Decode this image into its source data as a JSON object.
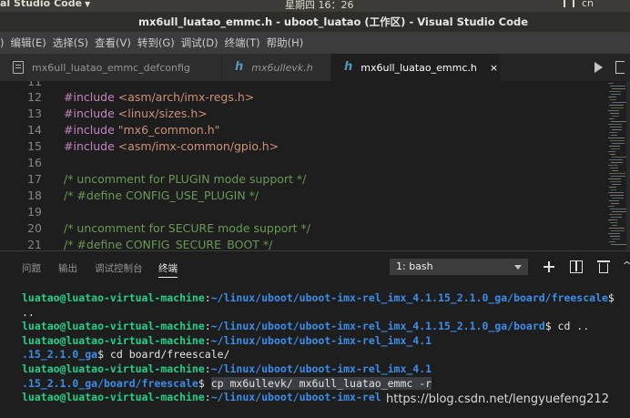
{
  "topbar": {
    "app_name": "al Studio Code",
    "clock": "星期四 16：26",
    "input_method": "cn"
  },
  "window": {
    "title": "mx6ull_luatao_emmc.h - uboot_luatao (工作区) - Visual Studio Code"
  },
  "menu": {
    "items": [
      "编辑(E)",
      "选择(S)",
      "查看(V)",
      "转到(G)",
      "调试(D)",
      "终端(T)",
      "帮助(H)"
    ],
    "first_partial": ")"
  },
  "tabs": [
    {
      "label": "mx6ull_luatao_emmc_defconfig",
      "icon": "file-icon"
    },
    {
      "label": "mx6ullevk.h",
      "icon": "h-file-icon"
    },
    {
      "label": "mx6ull_luatao_emmc.h",
      "icon": "h-file-icon",
      "active": true,
      "close": "×"
    }
  ],
  "editor": {
    "lines": [
      {
        "num": "11",
        "kw": "",
        "text": "",
        "kind": "plain"
      },
      {
        "num": "12",
        "kw": "#include ",
        "text": "<asm/arch/imx-regs.h>",
        "kind": "include"
      },
      {
        "num": "13",
        "kw": "#include ",
        "text": "<linux/sizes.h>",
        "kind": "include"
      },
      {
        "num": "14",
        "kw": "#include ",
        "text": "\"mx6_common.h\"",
        "kind": "include"
      },
      {
        "num": "15",
        "kw": "#include ",
        "text": "<asm/imx-common/gpio.h>",
        "kind": "include"
      },
      {
        "num": "16",
        "kw": "",
        "text": "",
        "kind": "plain"
      },
      {
        "num": "17",
        "kw": "",
        "text": "/* uncomment for PLUGIN mode support */",
        "kind": "comment"
      },
      {
        "num": "18",
        "kw": "",
        "text": "/* #define CONFIG_USE_PLUGIN */",
        "kind": "comment"
      },
      {
        "num": "19",
        "kw": "",
        "text": "",
        "kind": "plain"
      },
      {
        "num": "20",
        "kw": "",
        "text": "/* uncomment for SECURE mode support */",
        "kind": "comment"
      },
      {
        "num": "21",
        "kw": "",
        "text": "/* #define CONFIG_SECURE_BOOT */",
        "kind": "comment"
      }
    ]
  },
  "panel": {
    "tabs": [
      "问题",
      "输出",
      "调试控制台",
      "终端"
    ],
    "active_tab": "终端",
    "terminal_select": "1: bash"
  },
  "terminal": {
    "lines": [
      {
        "user": "luatao@luatao-virtual-machine",
        "sep": ":",
        "path": "~/linux/uboot/uboot-imx-rel_imx_4.1.15_2.1.0_ga/board/freescale",
        "tail": "$",
        "sel": ""
      },
      {
        "user": "",
        "sep": "",
        "path": "",
        "tail": "..",
        "sel": ""
      },
      {
        "user": "luatao@luatao-virtual-machine",
        "sep": ":",
        "path": "~/linux/uboot/uboot-imx-rel_imx_4.1.15_2.1.0_ga/board",
        "tail": "$ cd ..",
        "sel": ""
      },
      {
        "user": "luatao@luatao-virtual-machine",
        "sep": ":",
        "path": "~/linux/uboot/uboot-imx-rel_imx_4.1",
        "tail": "",
        "sel": ""
      },
      {
        "user": "",
        "sep": "",
        "path": ".15_2.1.0_ga",
        "tail": "$ cd board/freescale/",
        "sel": ""
      },
      {
        "user": "luatao@luatao-virtual-machine",
        "sep": ":",
        "path": "~/linux/uboot/uboot-imx-rel_imx_4.1",
        "tail": "",
        "sel": ""
      },
      {
        "user": "",
        "sep": "",
        "path": ".15_2.1.0_ga/board/freescale",
        "tail": "$ ",
        "sel": "cp mx6ullevk/ mx6ull_luatao_emmc -r"
      },
      {
        "user": "luatao@luatao-virtual-machine",
        "sep": ":",
        "path": "~/linux/uboot/uboot-imx-rel",
        "tail": "",
        "sel": ""
      }
    ]
  },
  "watermark": "https://blog.csdn.net/lengyuefeng212",
  "colors": {
    "editor_bg": "#1e1e1e",
    "keyword": "#c586c0",
    "string": "#ce9178",
    "comment": "#6a9955",
    "term_user": "#23d18b",
    "term_path": "#3b8eea"
  }
}
